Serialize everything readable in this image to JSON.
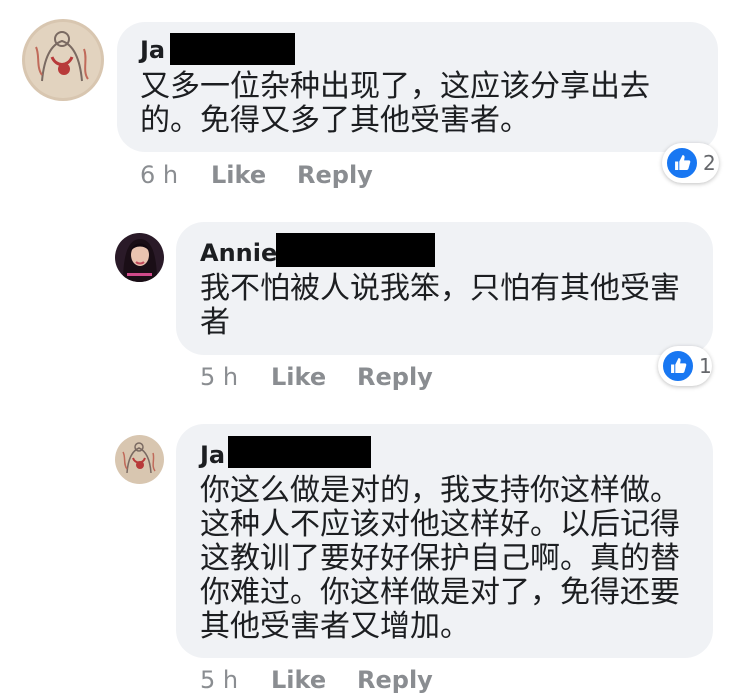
{
  "comments": [
    {
      "author_visible": "Ja",
      "text": "又多一位杂种出现了，这应该分享出去的。免得又多了其他受害者。",
      "time": "6 h",
      "like_label": "Like",
      "reply_label": "Reply",
      "reaction_count": "2",
      "avatar_icon": "illustrated-figure-avatar"
    },
    {
      "author_visible": "Annie",
      "text": "我不怕被人说我笨，只怕有其他受害者",
      "time": "5 h",
      "like_label": "Like",
      "reply_label": "Reply",
      "reaction_count": "1",
      "avatar_icon": "woman-portrait-avatar"
    },
    {
      "author_visible": "Ja",
      "text": "你这么做是对的，我支持你这样做。这种人不应该对他这样好。以后记得这教训了要好好保护自己啊。真的替你难过。你这样做是对了，免得还要其他受害者又增加。",
      "time": "5 h",
      "like_label": "Like",
      "reply_label": "Reply",
      "avatar_icon": "illustrated-figure-avatar"
    }
  ],
  "colors": {
    "bubble": "#f0f2f5",
    "meta": "#8a8d91",
    "like_reaction": "#1877f2",
    "redaction": "#000000"
  }
}
